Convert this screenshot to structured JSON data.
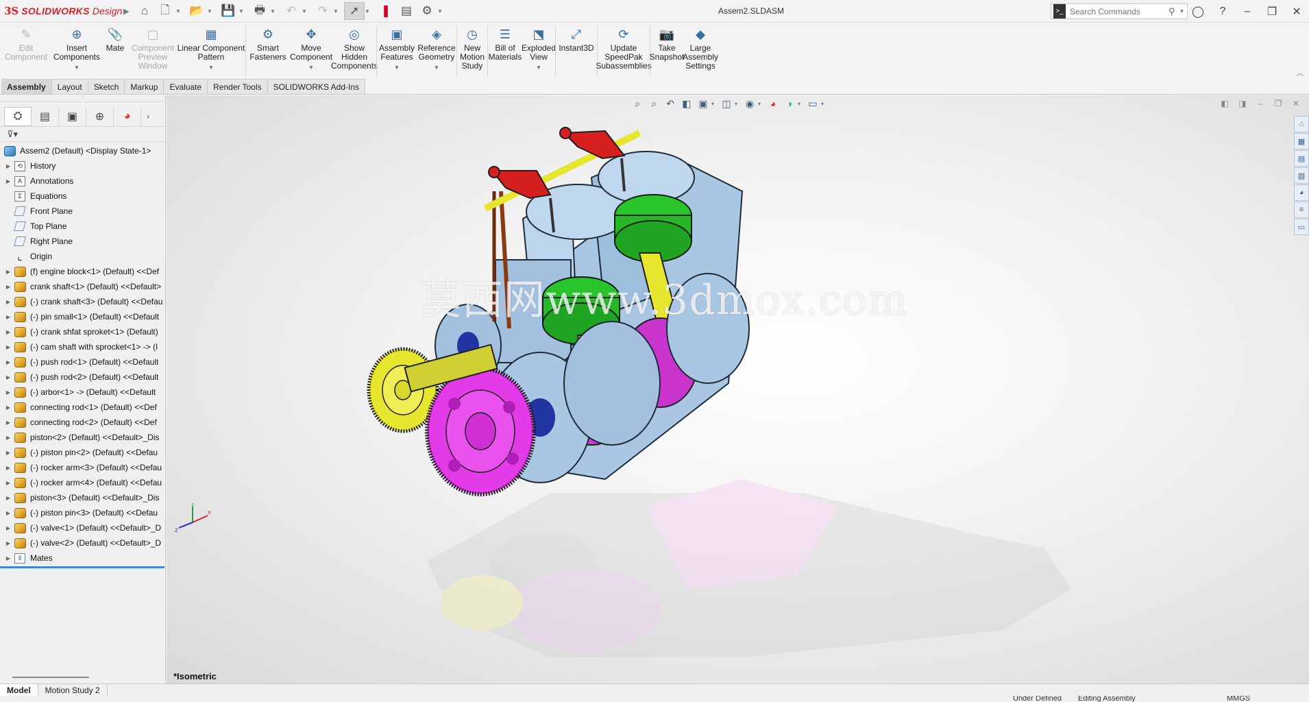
{
  "app": {
    "logo_ds": "3S",
    "logo_brand": "SOLIDWORKS",
    "logo_suffix": "Design",
    "document_title": "Assem2.SLDASM"
  },
  "search": {
    "placeholder": "Search Commands"
  },
  "ribbon": {
    "buttons": [
      {
        "label": "Edit\nComponent",
        "disabled": true
      },
      {
        "label": "Insert\nComponents",
        "has_arrow": true
      },
      {
        "label": "Mate"
      },
      {
        "label": "Component\nPreview\nWindow",
        "disabled": true
      },
      {
        "label": "Linear Component\nPattern",
        "has_arrow": true
      },
      {
        "label": "Smart\nFasteners"
      },
      {
        "label": "Move\nComponent",
        "has_arrow": true
      },
      {
        "label": "Show\nHidden\nComponents"
      },
      {
        "label": "Assembly\nFeatures",
        "has_arrow": true
      },
      {
        "label": "Reference\nGeometry",
        "has_arrow": true
      },
      {
        "label": "New\nMotion\nStudy"
      },
      {
        "label": "Bill of\nMaterials"
      },
      {
        "label": "Exploded\nView",
        "has_arrow": true
      },
      {
        "label": "Instant3D"
      },
      {
        "label": "Update\nSpeedPak\nSubassemblies"
      },
      {
        "label": "Take\nSnapshot"
      },
      {
        "label": "Large\nAssembly\nSettings"
      }
    ]
  },
  "tabs": [
    "Assembly",
    "Layout",
    "Sketch",
    "Markup",
    "Evaluate",
    "Render Tools",
    "SOLIDWORKS Add-Ins"
  ],
  "active_tab": "Assembly",
  "tree": {
    "root": "Assem2 (Default) <Display State-1>",
    "features": [
      {
        "label": "History",
        "expandable": true,
        "icon": "history-icon"
      },
      {
        "label": "Annotations",
        "expandable": true,
        "icon": "annotations-icon"
      },
      {
        "label": "Equations",
        "expandable": false,
        "icon": "equations-icon"
      },
      {
        "label": "Front Plane",
        "expandable": false,
        "icon": "plane-icon"
      },
      {
        "label": "Top Plane",
        "expandable": false,
        "icon": "plane-icon"
      },
      {
        "label": "Right Plane",
        "expandable": false,
        "icon": "plane-icon"
      },
      {
        "label": "Origin",
        "expandable": false,
        "icon": "origin-icon"
      }
    ],
    "components": [
      "(f) engine block<1> (Default) <<Def",
      "crank shaft<1> (Default) <<Default>",
      "(-) crank shaft<3> (Default) <<Defau",
      "(-) pin small<1> (Default) <<Default",
      "(-) crank shfat sproket<1> (Default)",
      "(-) cam shaft with sprocket<1> -> (I",
      "(-) push rod<1> (Default) <<Default",
      "(-) push rod<2> (Default) <<Default",
      "(-) arbor<1> -> (Default) <<Default",
      "connecting rod<1> (Default) <<Def",
      "connecting rod<2> (Default) <<Def",
      "piston<2> (Default) <<Default>_Dis",
      "(-) piston pin<2> (Default) <<Defau",
      "(-) rocker arm<3> (Default) <<Defau",
      "(-) rocker arm<4> (Default) <<Defau",
      "piston<3> (Default) <<Default>_Dis",
      "(-) piston pin<3> (Default) <<Defau",
      "(-) valve<1> (Default) <<Default>_D",
      "(-) valve<2> (Default) <<Default>_D"
    ],
    "mates": "Mates"
  },
  "viewport": {
    "view_name": "*Isometric",
    "watermark": "莫西网www.3dmox.com"
  },
  "bottom_tabs": [
    "Model",
    "Motion Study 2"
  ],
  "status": {
    "definition": "Under Defined",
    "mode": "Editing Assembly",
    "units": "MMGS"
  },
  "colors": {
    "accent": "#3e8ad6",
    "brand_red": "#d2232a",
    "block": "#a9c7e3",
    "piston": "#2fbf2f",
    "crank": "#d23ad6",
    "rod": "#e6e62e",
    "rocker": "#d62020"
  }
}
